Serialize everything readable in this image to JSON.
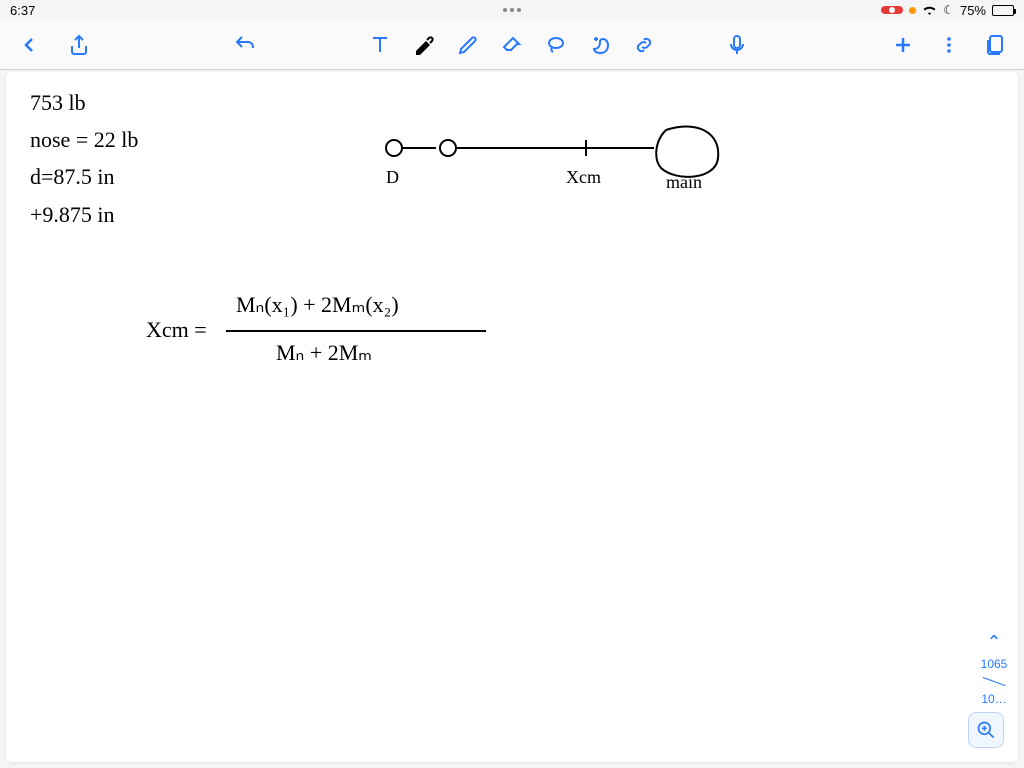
{
  "status": {
    "time": "6:37",
    "battery_pct": "75%",
    "wifi": "wifi-icon",
    "moon": "☾"
  },
  "toolbar": {
    "back": "chevron-left",
    "share": "share",
    "undo": "undo",
    "text": "T",
    "marker": "marker",
    "pencil": "pencil",
    "eraser": "eraser",
    "lasso": "lasso",
    "hand": "hand",
    "link": "link",
    "mic": "mic",
    "add": "+",
    "more": "⋮",
    "pages": "pages"
  },
  "notes": {
    "line1": "753 lb",
    "line2": "nose = 22 lb",
    "line3": "d=87.5 in",
    "line4": "+9.875 in",
    "diagram_D": "D",
    "diagram_xcm": "Xcm",
    "diagram_main": "main",
    "eq_lhs": "Xcm =",
    "eq_num": "Mₙ(x₁) + 2Mₘ(x₂)",
    "eq_den": "Mₙ + 2Mₘ"
  },
  "nav": {
    "current": "1065",
    "total": "10…"
  },
  "colors": {
    "accent": "#2979ff",
    "rec": "#e53935"
  }
}
